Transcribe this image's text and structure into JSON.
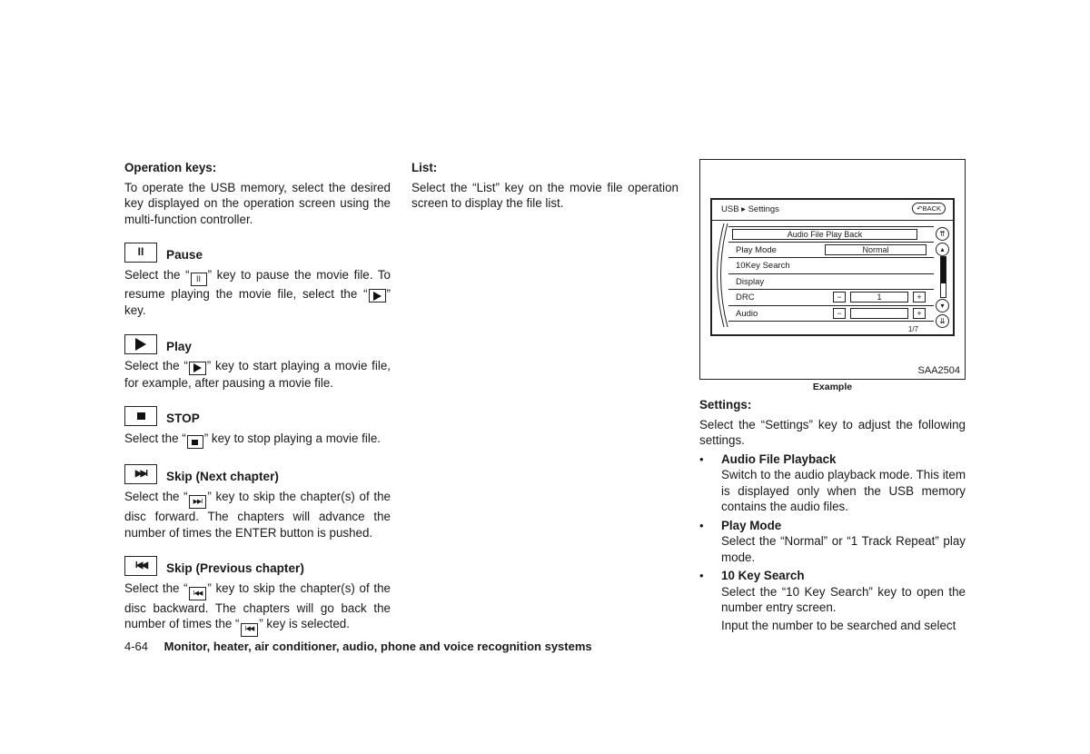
{
  "col1": {
    "heading": "Operation keys:",
    "intro": "To operate the USB memory, select the desired key displayed on the operation screen using the multi-function controller.",
    "keys": [
      {
        "title": "Pause",
        "icon": "pause-icon",
        "text_a": "Select the “",
        "text_b": "” key to pause the movie file. To resume playing the movie file, select the “",
        "text_c": "” key."
      },
      {
        "title": "Play",
        "icon": "play-icon",
        "text_a": "Select the “",
        "text_b": "” key to start playing a movie file, for example, after pausing a movie file."
      },
      {
        "title": "STOP",
        "icon": "stop-icon",
        "text_a": "Select the “",
        "text_b": "” key to stop playing a movie file."
      },
      {
        "title": "Skip (Next chapter)",
        "icon": "skip-next-icon",
        "text_a": "Select the “",
        "text_b": "” key to skip the chapter(s) of the disc forward. The chapters will advance the number of times the ENTER button is pushed."
      },
      {
        "title": "Skip (Previous chapter)",
        "icon": "skip-previous-icon",
        "text_a": "Select the “",
        "text_b": "” key to skip the chapter(s) of the disc backward. The chapters will go back the number of times the “",
        "text_c": "” key is selected."
      }
    ],
    "glyphs": {
      "pause": "II",
      "next": "▶▶I",
      "prev": "I◀◀"
    }
  },
  "col2": {
    "heading": "List:",
    "text": "Select the “List” key on the movie file operation screen to display the file list."
  },
  "figure": {
    "screen_title": "USB ▸ Settings",
    "back_label": "BACK",
    "top_item": "Audio File Play Back",
    "rows": [
      {
        "label": "Play Mode",
        "value": "Normal"
      },
      {
        "label": "10Key Search"
      },
      {
        "label": "Display"
      },
      {
        "label": "DRC",
        "value": "1",
        "minus": "−",
        "plus": "+"
      },
      {
        "label": "Audio",
        "value": "",
        "minus": "−",
        "plus": "+"
      }
    ],
    "pager": "1/7",
    "code": "SAA2504",
    "caption": "Example"
  },
  "col3": {
    "heading": "Settings:",
    "intro": "Select the “Settings” key to adjust the following settings.",
    "bullets": [
      {
        "title": "Audio File Playback",
        "body": [
          "Switch to the audio playback mode. This item is displayed only when the USB memory contains the audio files."
        ]
      },
      {
        "title": "Play Mode",
        "body": [
          "Select the “Normal” or “1 Track Repeat” play mode."
        ]
      },
      {
        "title": "10 Key Search",
        "body": [
          "Select the “10 Key Search” key to open the number entry screen.",
          "Input the number to be searched and select"
        ]
      }
    ],
    "bullet_char": "•"
  },
  "footer": {
    "page": "4-64",
    "title": "Monitor, heater, air conditioner, audio, phone and voice recognition systems"
  }
}
